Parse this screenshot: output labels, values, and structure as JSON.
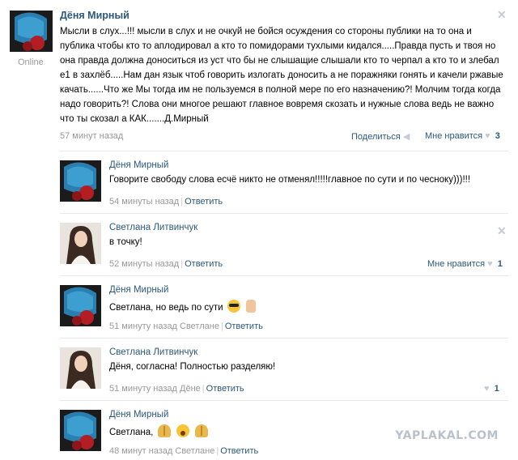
{
  "post": {
    "author": "Дёня Мирный",
    "online": "Online",
    "text": "Мысли в слух...!!! мысли в слух и не очкуй не бойся осуждения со стороны публики на то она и публика чтобы кто то аплодировал а кто то помидорами тухлыми кидался.....Правда пусть и твоя но она правда должна доноситься из уст что бы не слышащие слышали кто то черпал а кто то и злебал е1 в захлёб.....Нам дан язык чтоб говорить излогать доносить а не поражняки гонять и качели ржавые качать......Что же Мы тогда им не пользуемся в полной мере по его назначению?! Молчим тогда когда надо говорить?! Слова они многое решают главное вовремя скозать и нужные слова ведь не важно что ты скозал а КАК.......Д.Мирный",
    "time": "57 минут назад",
    "share": "Поделиться",
    "like_label": "Мне нравится",
    "like_count": "3"
  },
  "comments": [
    {
      "author": "Дёня Мирный",
      "text": "Говорите свободу слова есчё никто не отменял!!!!!главное по сути и по чесноку)))!!!",
      "time": "54 минуты назад",
      "reply_to": "",
      "reply": "Ответить"
    },
    {
      "author": "Светлана Литвинчук",
      "text": "в точку!",
      "time": "52 минуты назад",
      "reply_to": "",
      "reply": "Ответить",
      "like_label": "Мне нравится",
      "like_count": "1"
    },
    {
      "author": "Дёня Мирный",
      "text": "Светлана, но ведь по сути",
      "time": "51 минуту назад",
      "reply_to": "Светлане",
      "reply": "Ответить"
    },
    {
      "author": "Светлана Литвинчук",
      "text": "Дёня, согласна! Полностью разделяю!",
      "time": "51 минуту назад",
      "reply_to": "Дёне",
      "reply": "Ответить",
      "like_count": "1"
    },
    {
      "author": "Дёня Мирный",
      "text": "Светлана,",
      "time": "48 минут назад",
      "reply_to": "Светлане",
      "reply": "Ответить"
    }
  ],
  "icons": {
    "close": "close-icon",
    "share": "megaphone-icon",
    "like": "heart-icon"
  },
  "colors": {
    "link": "#2b587a",
    "muted": "#999999",
    "separator": "#e7eaed"
  },
  "watermark": "YAPLAKAL.COM"
}
